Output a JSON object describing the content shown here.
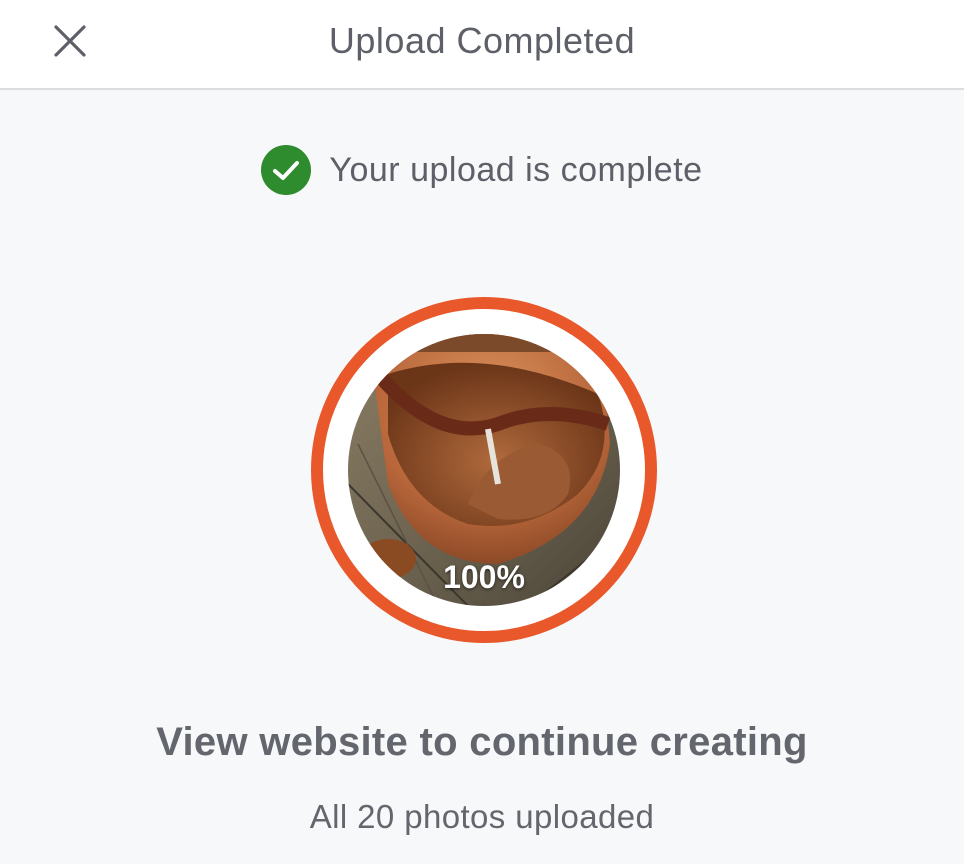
{
  "header": {
    "title": "Upload Completed",
    "close_icon": "close-icon"
  },
  "status": {
    "icon": "check-circle-icon",
    "text": "Your upload is complete",
    "icon_color": "#2e8b2e"
  },
  "progress": {
    "percent_label": "100%",
    "value": 1.0,
    "ring_color": "#e8582b",
    "thumbnail": "uploaded-photo-wooden-bowl"
  },
  "cta": {
    "text": "View website to continue creating"
  },
  "summary": {
    "text": "All 20 photos uploaded"
  }
}
